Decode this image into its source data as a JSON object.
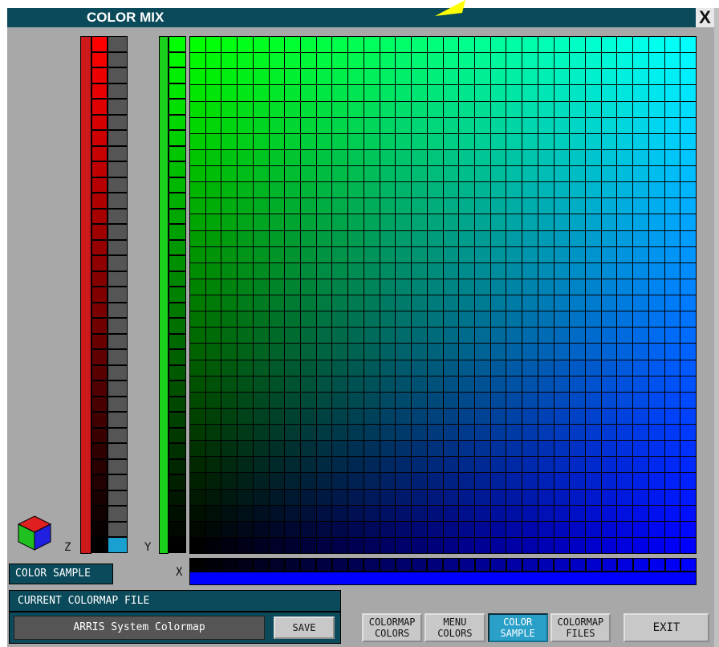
{
  "window": {
    "title": "COLOR MIX",
    "close_label": "X"
  },
  "axes": {
    "z_label": "Z",
    "y_label": "Y",
    "x_label": "X"
  },
  "color_sample": {
    "label": "COLOR SAMPLE"
  },
  "colormap_file": {
    "section_label": "CURRENT COLORMAP FILE",
    "value": "ARRIS System Colormap",
    "save_label": "SAVE"
  },
  "tabs": [
    {
      "line1": "COLORMAP",
      "line2": "COLORS",
      "active": false
    },
    {
      "line1": "MENU",
      "line2": "COLORS",
      "active": false
    },
    {
      "line1": "COLOR",
      "line2": "SAMPLE",
      "active": true
    },
    {
      "line1": "COLORMAP",
      "line2": "FILES",
      "active": false
    }
  ],
  "exit_label": "EXIT",
  "icons": {
    "cube": "rgb-cube-icon",
    "close": "close-icon",
    "pointer": "arrow-pointer-icon"
  },
  "colors": {
    "title_bar": "#0a4a5a",
    "active_tab": "#2aa0c8",
    "selected_z": "#1aa0d0"
  }
}
